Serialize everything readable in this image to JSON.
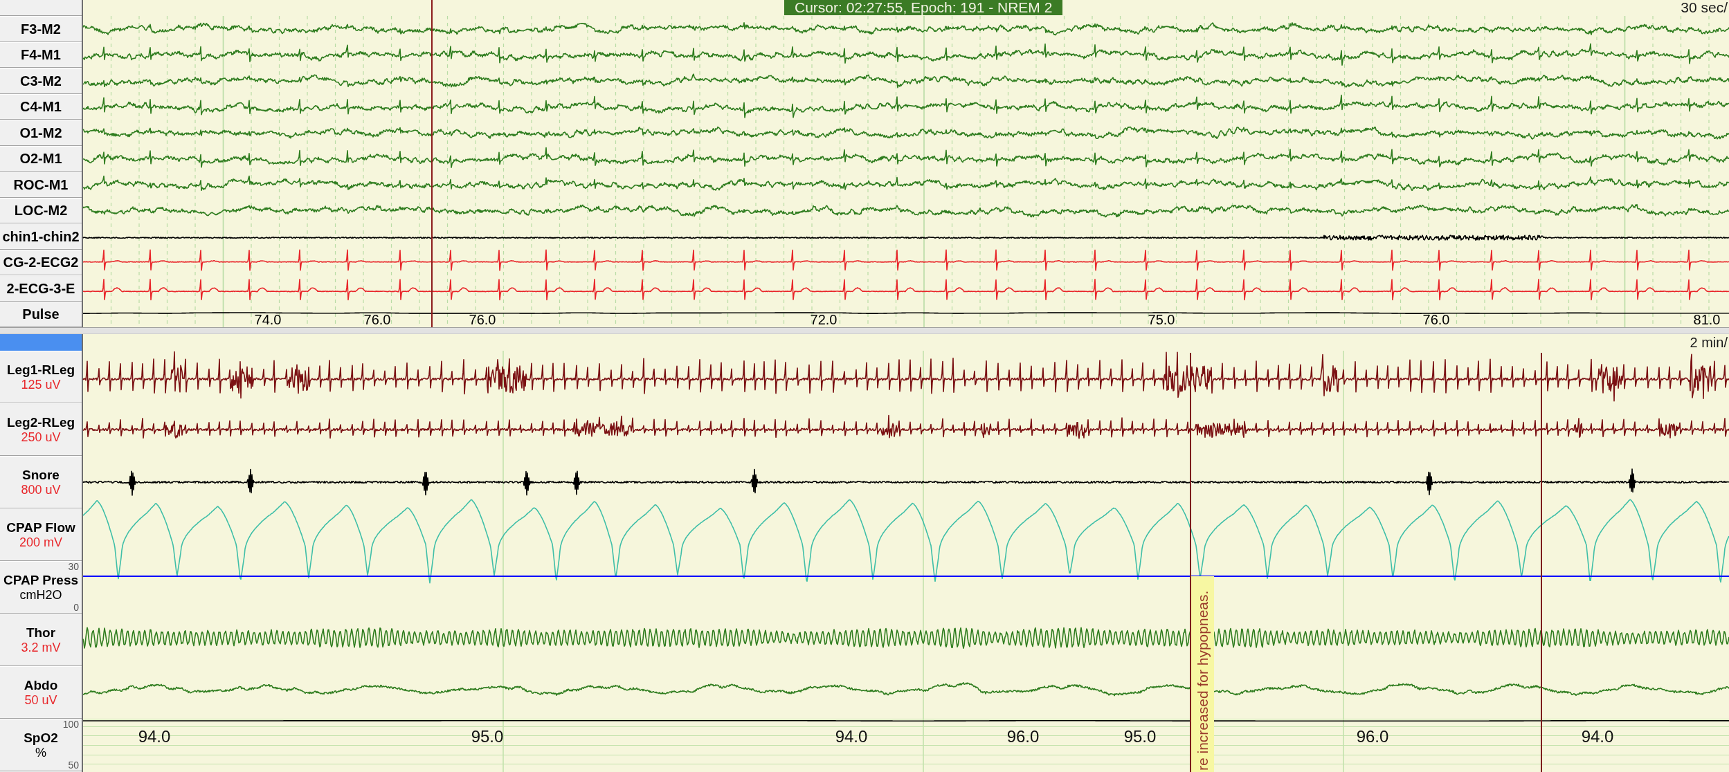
{
  "cursor_status": "Cursor: 02:27:55, Epoch: 191 - NREM 2",
  "epoch_panel": {
    "timescale": "30 sec/",
    "channels": [
      {
        "label": "F3-M2",
        "kind": "eeg",
        "color": "#2f7d1f"
      },
      {
        "label": "F4-M1",
        "kind": "eeg",
        "color": "#2f7d1f"
      },
      {
        "label": "C3-M2",
        "kind": "eeg",
        "color": "#2f7d1f"
      },
      {
        "label": "C4-M1",
        "kind": "eeg",
        "color": "#2f7d1f"
      },
      {
        "label": "O1-M2",
        "kind": "eeg",
        "color": "#2f7d1f"
      },
      {
        "label": "O2-M1",
        "kind": "eeg",
        "color": "#2f7d1f"
      },
      {
        "label": "ROC-M1",
        "kind": "eeg",
        "color": "#2f7d1f"
      },
      {
        "label": "LOC-M2",
        "kind": "eeg",
        "color": "#2f7d1f"
      },
      {
        "label": "chin1-chin2",
        "kind": "emg",
        "color": "#000000"
      },
      {
        "label": "CG-2-ECG2",
        "kind": "ecg",
        "color": "#e8262a"
      },
      {
        "label": "2-ECG-3-E",
        "kind": "ecg",
        "color": "#e8262a"
      },
      {
        "label": "Pulse",
        "kind": "pulse",
        "color": "#000000",
        "readings": [
          "74.0",
          "76.0",
          "76.0",
          "72.0",
          "75.0",
          "76.0",
          "81.0"
        ]
      }
    ]
  },
  "overview_panel": {
    "timescale": "2 min/",
    "channels": [
      {
        "label": "Leg1-RLeg",
        "kind": "leg",
        "color": "#7b1113",
        "gain": "125 uV"
      },
      {
        "label": "Leg2-RLeg",
        "kind": "leg",
        "color": "#7b1113",
        "gain": "250 uV"
      },
      {
        "label": "Snore",
        "kind": "snore",
        "color": "#000000",
        "gain": "800 uV"
      },
      {
        "label": "CPAP Flow",
        "kind": "flow",
        "color": "#3fbfa8",
        "gain": "200 mV"
      },
      {
        "label": "CPAP Press",
        "kind": "pressure",
        "color": "#0000ff",
        "unit": "cmH2O",
        "range_max": "30",
        "range_min": "0"
      },
      {
        "label": "Thor",
        "kind": "effort",
        "color": "#2f7d1f",
        "gain": "3.2 mV"
      },
      {
        "label": "Abdo",
        "kind": "abdomen",
        "color": "#2f7d1f",
        "gain": "50 uV"
      },
      {
        "label": "SpO2",
        "kind": "spo2",
        "color": "#000000",
        "unit": "%",
        "range_max": "100",
        "range_min": "50",
        "readings": [
          "94.0",
          "95.0",
          "94.0",
          "96.0",
          "95.0",
          "96.0",
          "94.0"
        ]
      }
    ],
    "annotation": {
      "text": "re increased for hypopneas."
    }
  }
}
